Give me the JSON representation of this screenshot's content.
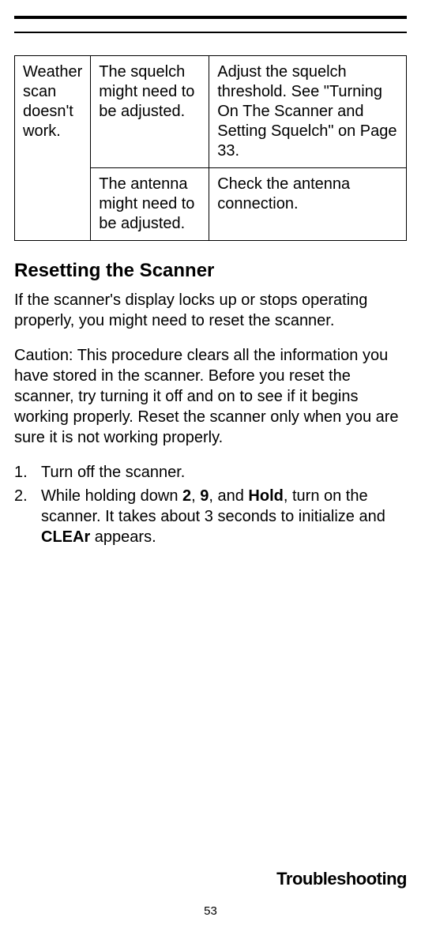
{
  "table": {
    "row1": {
      "problem": "Weather scan doesn't work.",
      "cause": "The squelch might need to be adjusted.",
      "solution": "Adjust the squelch threshold. See \"Turning On The Scanner and Setting Squelch\" on Page 33."
    },
    "row2": {
      "cause": "The antenna might need to be adjusted.",
      "solution": "Check the antenna connection."
    }
  },
  "heading": "Resetting the Scanner",
  "para1": "If the scanner's display locks up or stops operating properly, you might need to reset the scanner.",
  "para2": "Caution: This procedure clears all the information you have stored in the scanner. Before you reset the scanner, try turning it off and on to see if it begins working properly. Reset the scanner only when you are sure it is not working properly.",
  "steps": {
    "s1": "Turn off the scanner.",
    "s2a": "While holding down ",
    "s2b": "2",
    "s2c": ", ",
    "s2d": "9",
    "s2e": ", and ",
    "s2f": "Hold",
    "s2g": ", turn on the scanner. It takes about 3 seconds to initialize and ",
    "s2h": "CLEAr",
    "s2i": " appears."
  },
  "footerTitle": "Troubleshooting",
  "pageNumber": "53"
}
